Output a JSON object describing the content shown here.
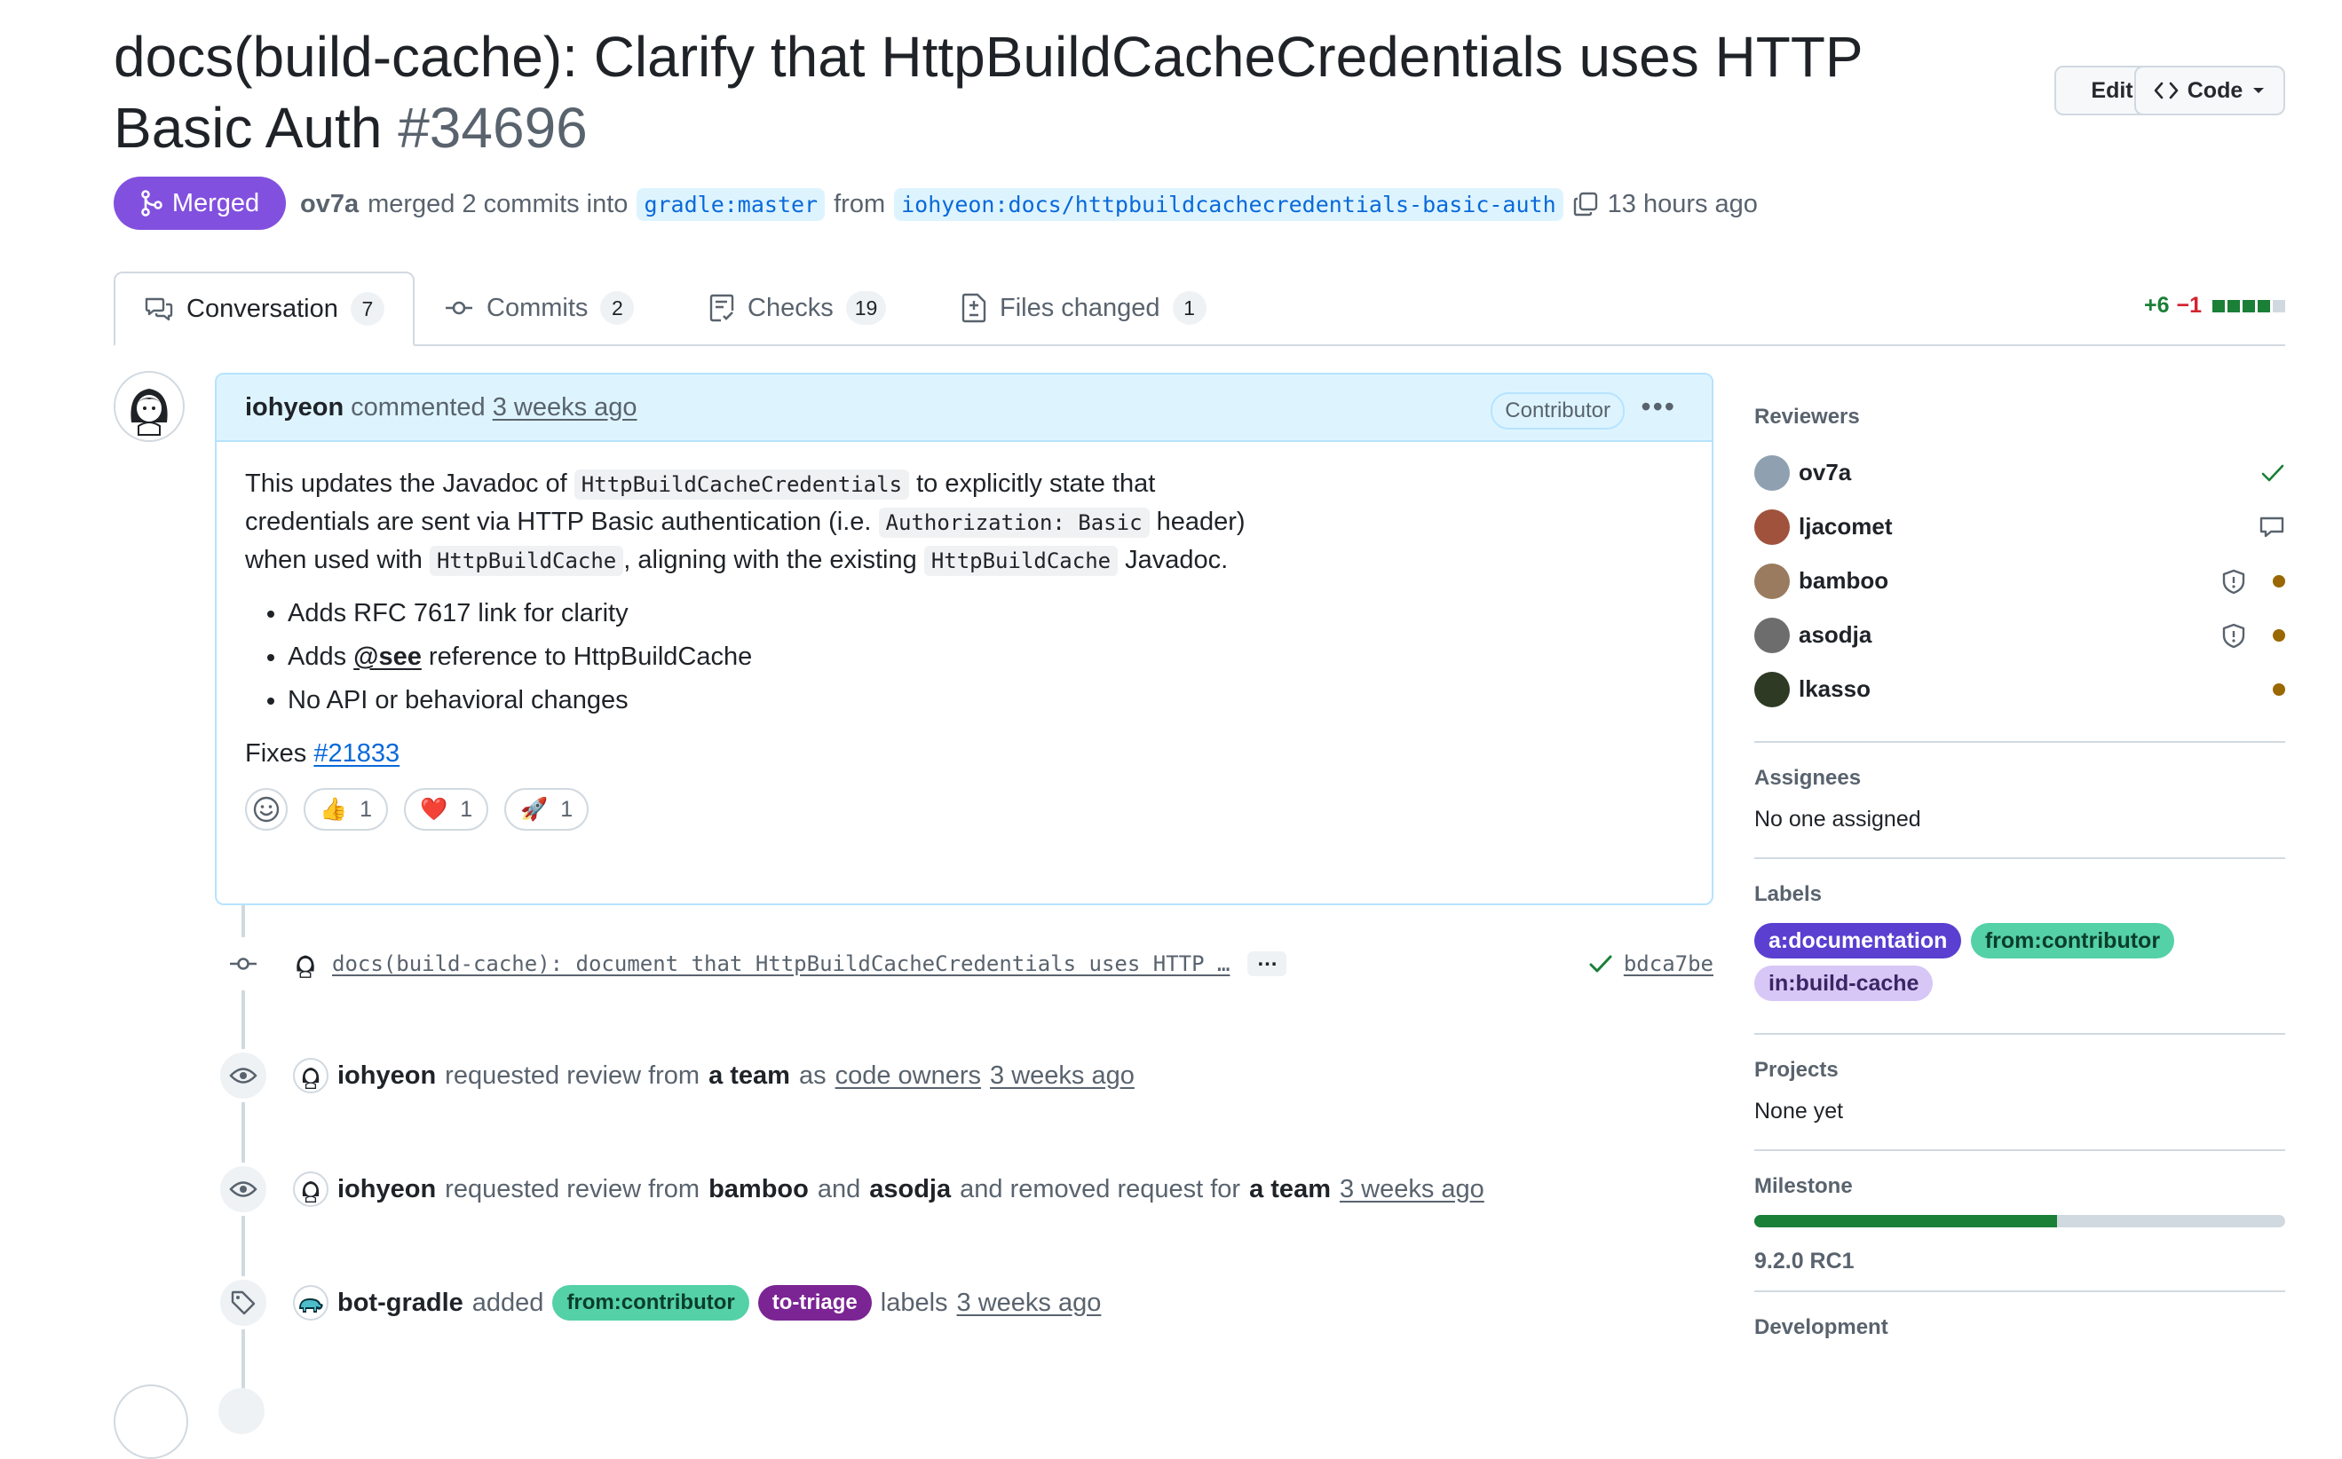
{
  "pr": {
    "title": "docs(build-cache): Clarify that HttpBuildCacheCredentials uses HTTP Basic Auth",
    "number": "#34696",
    "state": "Merged",
    "author": "ov7a",
    "merged_text": "merged 2 commits into",
    "base_branch": "gradle:master",
    "from_text": "from",
    "head_branch": "iohyeon:docs/httpbuildcachecredentials-basic-auth",
    "time": "13 hours ago"
  },
  "header_buttons": {
    "edit": "Edit",
    "code": "Code"
  },
  "tabs": [
    {
      "label": "Conversation",
      "count": "7"
    },
    {
      "label": "Commits",
      "count": "2"
    },
    {
      "label": "Checks",
      "count": "19"
    },
    {
      "label": "Files changed",
      "count": "1"
    }
  ],
  "diffstat": {
    "additions": "+6",
    "deletions": "−1"
  },
  "comment": {
    "author": "iohyeon",
    "action": "commented",
    "time": "3 weeks ago",
    "role": "Contributor",
    "p1_a": "This updates the Javadoc of",
    "p1_code1": "HttpBuildCacheCredentials",
    "p1_b": "to explicitly state that",
    "p1_c": "credentials are sent via HTTP Basic authentication (i.e.",
    "p1_code2": "Authorization: Basic",
    "p1_d": "header)",
    "p1_e": "when used with",
    "p1_code3": "HttpBuildCache",
    "p1_f": ", aligning with the existing",
    "p1_code4": "HttpBuildCache",
    "p1_g": "Javadoc.",
    "bullets": [
      "Adds RFC 7617 link for clarity",
      "reference to HttpBuildCache",
      "No API or behavioral changes"
    ],
    "bullet2_mention": "@see",
    "bullet2_prefix": "Adds",
    "fixes_text": "Fixes",
    "fixes_link": "#21833",
    "reactions": [
      {
        "emoji": "👍",
        "count": "1"
      },
      {
        "emoji": "❤️",
        "count": "1"
      },
      {
        "emoji": "🚀",
        "count": "1"
      }
    ]
  },
  "timeline": {
    "commit": {
      "message": "docs(build-cache): document that HttpBuildCacheCredentials uses HTTP …",
      "more": "…",
      "sha": "bdca7be"
    },
    "event1": {
      "user": "iohyeon",
      "t1": "requested review from",
      "b1": "a team",
      "t2": "as",
      "link": "code owners",
      "time": "3 weeks ago"
    },
    "event2": {
      "user": "iohyeon",
      "t1": "requested review from",
      "b1": "bamboo",
      "t2": "and",
      "b2": "asodja",
      "t3": "and removed request for",
      "b3": "a team",
      "time": "3 weeks ago"
    },
    "event3": {
      "user": "bot-gradle",
      "t1": "added",
      "label1": "from:contributor",
      "label2": "to-triage",
      "t2": "labels",
      "time": "3 weeks ago"
    }
  },
  "sidebar": {
    "reviewers_title": "Reviewers",
    "reviewers": [
      "ov7a",
      "ljacomet",
      "bamboo",
      "asodja",
      "lkasso"
    ],
    "assignees_title": "Assignees",
    "assignees_text": "No one assigned",
    "labels_title": "Labels",
    "labels": [
      "a:documentation",
      "from:contributor",
      "in:build-cache"
    ],
    "projects_title": "Projects",
    "projects_text": "None yet",
    "milestone_title": "Milestone",
    "milestone_name": "9.2.0 RC1",
    "milestone_progress": 0.57,
    "development_title": "Development"
  },
  "colors": {
    "merged": "#8250df",
    "label_documentation": "#5a3fd1",
    "label_contributor": "#54d1a6",
    "label_build_cache": "#d7c7f6",
    "label_triage": "#7b2493"
  }
}
